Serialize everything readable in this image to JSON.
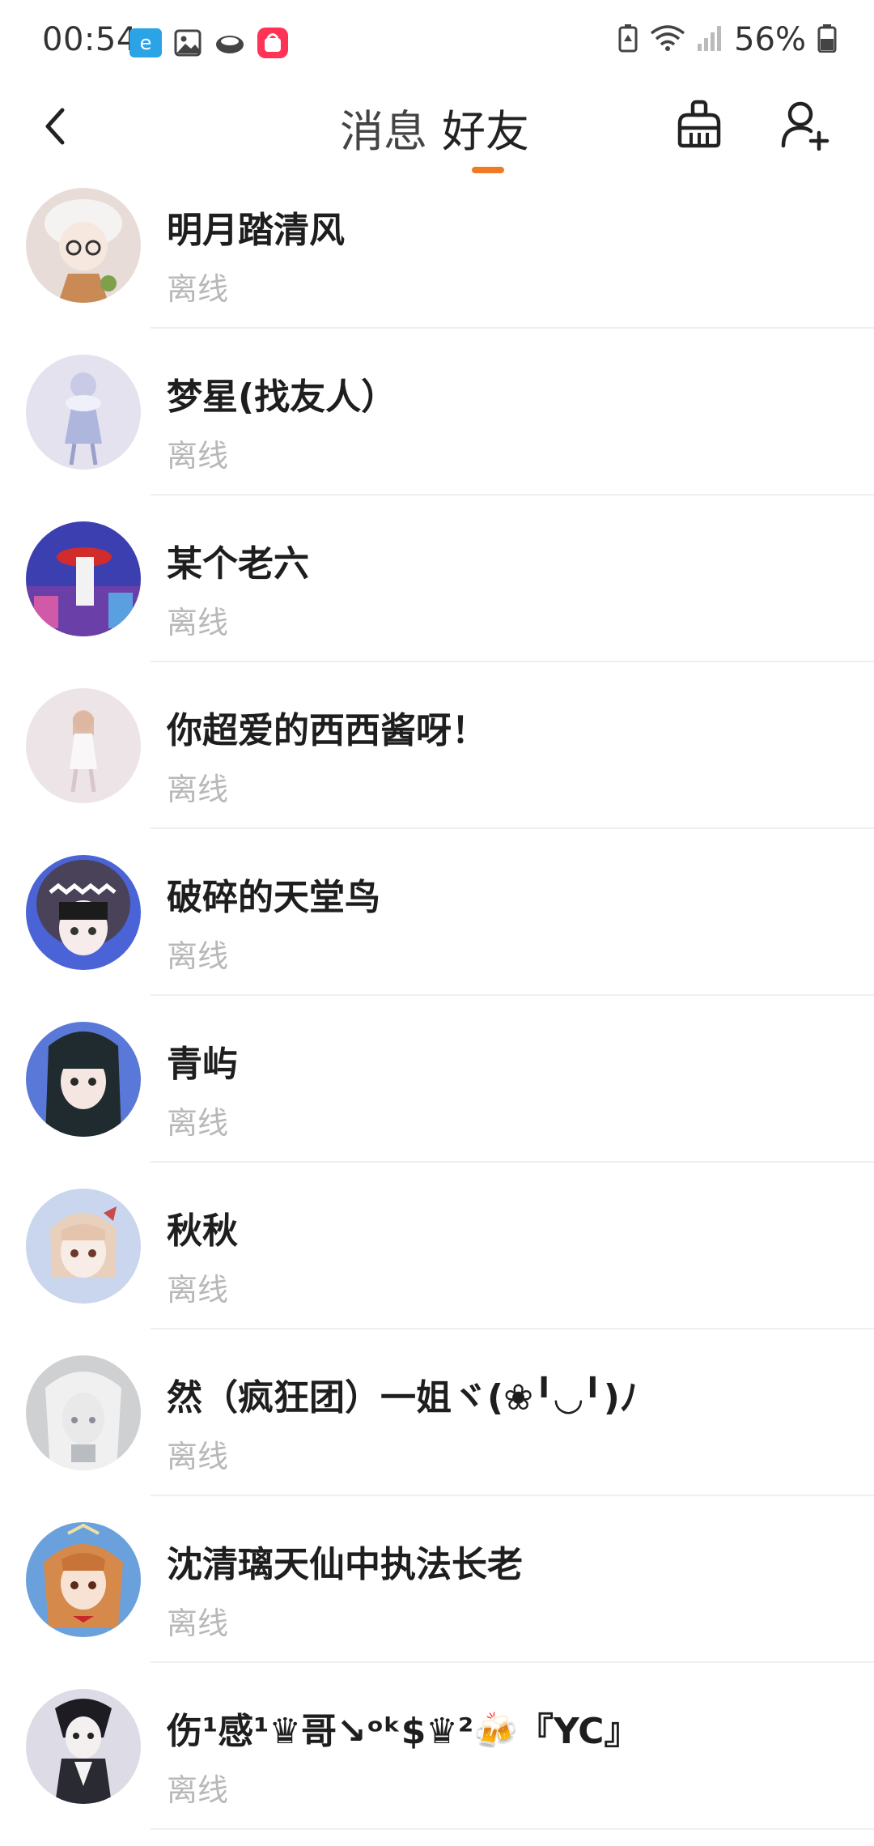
{
  "status_bar": {
    "time": "00:54",
    "battery": "56%"
  },
  "header": {
    "tabs": [
      {
        "label": "消息",
        "active": false
      },
      {
        "label": "好友",
        "active": true
      }
    ],
    "accent": "#f07a23"
  },
  "friends": [
    {
      "name": "明月踏清风",
      "status": "离线"
    },
    {
      "name": "梦星(找友人）",
      "status": "离线"
    },
    {
      "name": "某个老六",
      "status": "离线"
    },
    {
      "name": "你超爱的西西酱呀！",
      "status": "离线"
    },
    {
      "name": "破碎的天堂鸟",
      "status": "离线"
    },
    {
      "name": "青屿",
      "status": "离线"
    },
    {
      "name": "秋秋",
      "status": "离线"
    },
    {
      "name": "然（疯狂团）一姐ヾ(❀╹◡╹)ﾉ",
      "status": "离线"
    },
    {
      "name": "沈清璃天仙中执法长老",
      "status": "离线"
    },
    {
      "name": "伤¹感¹♛哥↘ᵒᵏ$♛²🍻『YC』",
      "status": "离线"
    }
  ]
}
